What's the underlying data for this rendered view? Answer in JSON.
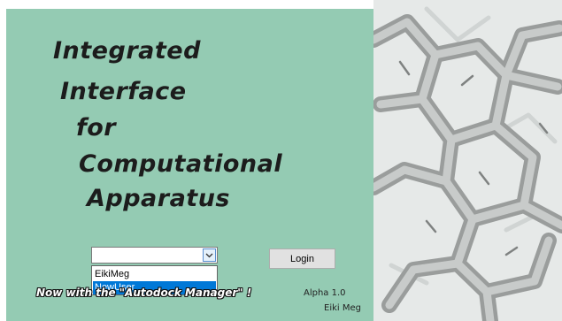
{
  "app": {
    "title_lines": [
      "Integrated",
      "Interface",
      "for",
      "Computational",
      "Apparatus"
    ]
  },
  "login": {
    "user_combo": {
      "value": "",
      "options": [
        "EikiMeg",
        "NewUser"
      ],
      "highlighted": "NewUser"
    },
    "login_label": "Login"
  },
  "footer": {
    "tagline": "Now with the \"Autodock Manager\" !",
    "version": "Alpha 1.0",
    "author": "Eiki Meg"
  },
  "colors": {
    "panel_bg": "#94cbb3",
    "title_text": "#1c1c1c",
    "selection": "#0078d7"
  },
  "icons": {
    "combo_arrow": "chevron-down-icon",
    "side_image": "molecular-structure-image"
  }
}
